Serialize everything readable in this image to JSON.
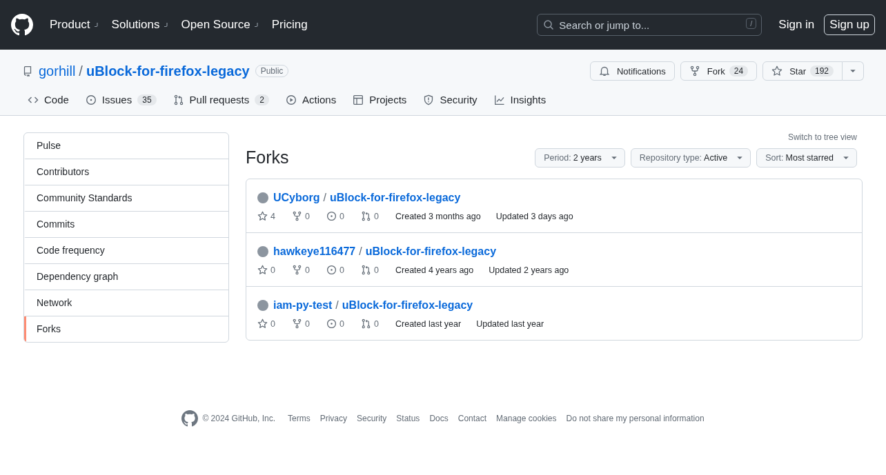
{
  "header": {
    "nav": [
      {
        "label": "Product",
        "dropdown": true
      },
      {
        "label": "Solutions",
        "dropdown": true
      },
      {
        "label": "Open Source",
        "dropdown": true
      },
      {
        "label": "Pricing",
        "dropdown": false
      }
    ],
    "search": {
      "placeholder": "Search or jump to...",
      "shortcut": "/"
    },
    "sign_in": "Sign in",
    "sign_up": "Sign up"
  },
  "repo": {
    "owner": "gorhill",
    "separator": "/",
    "name": "uBlock-for-firefox-legacy",
    "visibility": "Public",
    "actions": [
      {
        "kind": "notifications",
        "label": "Notifications"
      },
      {
        "kind": "fork",
        "label": "Fork",
        "count": "24"
      },
      {
        "kind": "star",
        "label": "Star",
        "count": "192"
      }
    ],
    "tabs": [
      {
        "kind": "code",
        "label": "Code"
      },
      {
        "kind": "issues",
        "label": "Issues",
        "count": "35"
      },
      {
        "kind": "pulls",
        "label": "Pull requests",
        "count": "2"
      },
      {
        "kind": "actions",
        "label": "Actions"
      },
      {
        "kind": "projects",
        "label": "Projects"
      },
      {
        "kind": "security",
        "label": "Security"
      },
      {
        "kind": "insights",
        "label": "Insights"
      }
    ]
  },
  "sidebar": {
    "items": [
      {
        "label": "Pulse",
        "selected": false
      },
      {
        "label": "Contributors",
        "selected": false
      },
      {
        "label": "Community Standards",
        "selected": false
      },
      {
        "label": "Commits",
        "selected": false
      },
      {
        "label": "Code frequency",
        "selected": false
      },
      {
        "label": "Dependency graph",
        "selected": false
      },
      {
        "label": "Network",
        "selected": false
      },
      {
        "label": "Forks",
        "selected": true
      }
    ]
  },
  "forks": {
    "title": "Forks",
    "switch_link": "Switch to tree view",
    "filters": [
      {
        "label": "Period:",
        "value": "2 years"
      },
      {
        "label": "Repository type:",
        "value": "Active"
      },
      {
        "label": "Sort:",
        "value": "Most starred"
      }
    ],
    "items": [
      {
        "owner": "UCyborg",
        "separator": "/",
        "repo": "uBlock-for-firefox-legacy",
        "stars": "4",
        "forks": "0",
        "issues": "0",
        "pulls": "0",
        "created": "Created 3 months ago",
        "updated": "Updated 3 days ago"
      },
      {
        "owner": "hawkeye116477",
        "separator": "/",
        "repo": "uBlock-for-firefox-legacy",
        "stars": "0",
        "forks": "0",
        "issues": "0",
        "pulls": "0",
        "created": "Created 4 years ago",
        "updated": "Updated 2 years ago"
      },
      {
        "owner": "iam-py-test",
        "separator": "/",
        "repo": "uBlock-for-firefox-legacy",
        "stars": "0",
        "forks": "0",
        "issues": "0",
        "pulls": "0",
        "created": "Created last year",
        "updated": "Updated last year"
      }
    ]
  },
  "footer": {
    "copyright": "© 2024 GitHub, Inc.",
    "links": [
      "Terms",
      "Privacy",
      "Security",
      "Status",
      "Docs",
      "Contact",
      "Manage cookies",
      "Do not share my personal information"
    ]
  }
}
